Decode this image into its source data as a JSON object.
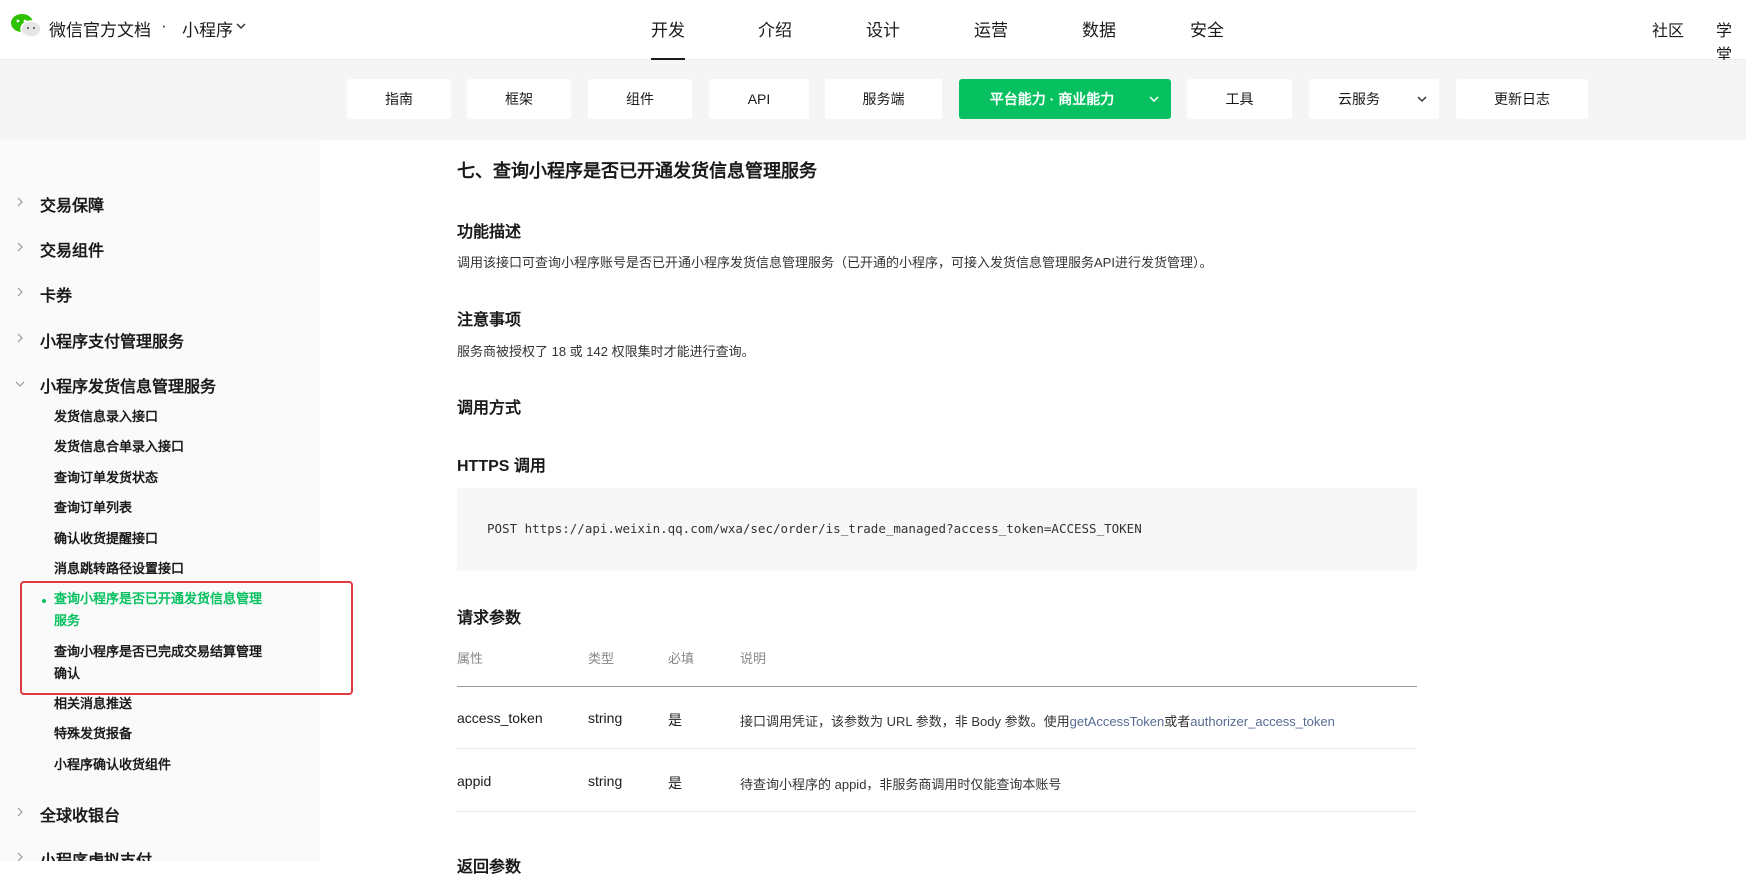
{
  "header": {
    "brand": "微信官方文档",
    "separator": "·",
    "product": "小程序",
    "main_nav": [
      "开发",
      "介绍",
      "设计",
      "运营",
      "数据",
      "安全"
    ],
    "active_nav": "开发",
    "right_links": [
      "社区",
      "学堂"
    ]
  },
  "subnav": {
    "tabs": [
      {
        "label": "指南"
      },
      {
        "label": "框架"
      },
      {
        "label": "组件"
      },
      {
        "label": "API"
      },
      {
        "label": "服务端"
      },
      {
        "label": "平台能力 · 商业能力"
      },
      {
        "label": "工具"
      },
      {
        "label": "云服务"
      },
      {
        "label": "更新日志"
      }
    ],
    "active_tab": "平台能力 · 商业能力"
  },
  "sidebar": {
    "groups_before": [
      "交易保障",
      "交易组件",
      "卡券",
      "小程序支付管理服务"
    ],
    "expanded_group": "小程序发货信息管理服务",
    "items": [
      "发货信息录入接口",
      "发货信息合单录入接口",
      "查询订单发货状态",
      "查询订单列表",
      "确认收货提醒接口",
      "消息跳转路径设置接口",
      "查询小程序是否已开通发货信息管理",
      "服务",
      "查询小程序是否已完成交易结算管理",
      "确认",
      "相关消息推送",
      "特殊发货报备",
      "小程序确认收货组件"
    ],
    "groups_after": [
      "全球收银台",
      "小程序虚拟支付"
    ]
  },
  "content": {
    "title": "七、查询小程序是否已开通发货信息管理服务",
    "desc_heading": "功能描述",
    "desc_text": "调用该接口可查询小程序账号是否已开通小程序发货信息管理服务（已开通的小程序，可接入发货信息管理服务API进行发货管理）。",
    "notice_heading": "注意事项",
    "notice_text": "服务商被授权了 18 或 142 权限集时才能进行查询。",
    "call_heading": "调用方式",
    "https_heading": "HTTPS 调用",
    "code": "POST https://api.weixin.qq.com/wxa/sec/order/is_trade_managed?access_token=ACCESS_TOKEN",
    "params_heading": "请求参数",
    "table_headers": [
      "属性",
      "类型",
      "必填",
      "说明"
    ],
    "rows": [
      {
        "name": "access_token",
        "type": "string",
        "required": "是",
        "desc_prefix": "接口调用凭证，该参数为 URL 参数，非 Body 参数。使用",
        "link1": "getAccessToken",
        "desc_mid": "或者",
        "link2": "authorizer_access_token"
      },
      {
        "name": "appid",
        "type": "string",
        "required": "是",
        "desc_prefix": "待查询小程序的 appid，非服务商调用时仅能查询本账号"
      }
    ],
    "next_heading": "返回参数"
  },
  "colors": {
    "accent_green": "#07c160",
    "link_blue": "#576b95",
    "highlight_red": "#e0393e"
  }
}
